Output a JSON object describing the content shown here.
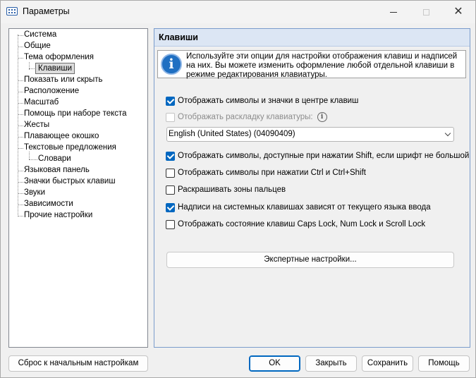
{
  "window": {
    "title": "Параметры",
    "app_icon": "keyboard-icon"
  },
  "tree": {
    "items": [
      {
        "label": "Система"
      },
      {
        "label": "Общие"
      },
      {
        "label": "Тема оформления"
      },
      {
        "label": "Клавиши",
        "selected": true
      },
      {
        "label": "Показать или скрыть"
      },
      {
        "label": "Расположение"
      },
      {
        "label": "Масштаб"
      },
      {
        "label": "Помощь при наборе текста"
      },
      {
        "label": "Жесты"
      },
      {
        "label": "Плавающее окошко"
      },
      {
        "label": "Текстовые предложения"
      },
      {
        "label": "Словари"
      },
      {
        "label": "Языковая панель"
      },
      {
        "label": "Значки быстрых клавиш"
      },
      {
        "label": "Звуки"
      },
      {
        "label": "Зависимости"
      },
      {
        "label": "Прочие настройки"
      }
    ]
  },
  "panel": {
    "header": "Клавиши",
    "info_icon": "info-icon",
    "info_text": "Используйте эти опции для настройки отображения клавиш и надписей на них. Вы можете изменить оформление любой отдельной клавиши в режиме редактирования клавиатуры.",
    "options": {
      "show_symbols_center": {
        "label": "Отображать символы и значки в центре клавиш",
        "checked": true
      },
      "show_layout": {
        "label": "Отображать раскладку клавиатуры:",
        "checked": false,
        "disabled": true
      },
      "show_shift_symbols": {
        "label": "Отображать символы, доступные при нажатии Shift, если шрифт не большой",
        "checked": true
      },
      "show_ctrl_symbols": {
        "label": "Отображать символы при нажатии Ctrl и Ctrl+Shift",
        "checked": false
      },
      "color_finger_zones": {
        "label": "Раскрашивать зоны пальцев",
        "checked": false
      },
      "system_keys_language": {
        "label": "Надписи на системных клавишах зависят от текущего языка ввода",
        "checked": true
      },
      "show_lock_state": {
        "label": "Отображать состояние клавиш Caps Lock, Num Lock и Scroll Lock",
        "checked": false
      }
    },
    "layout_select_value": "English (United States) (04090409)",
    "expert_button": "Экспертные настройки..."
  },
  "buttons": {
    "reset": "Сброс к начальным настройкам",
    "ok": "OK",
    "close": "Закрыть",
    "save": "Сохранить",
    "help": "Помощь"
  }
}
